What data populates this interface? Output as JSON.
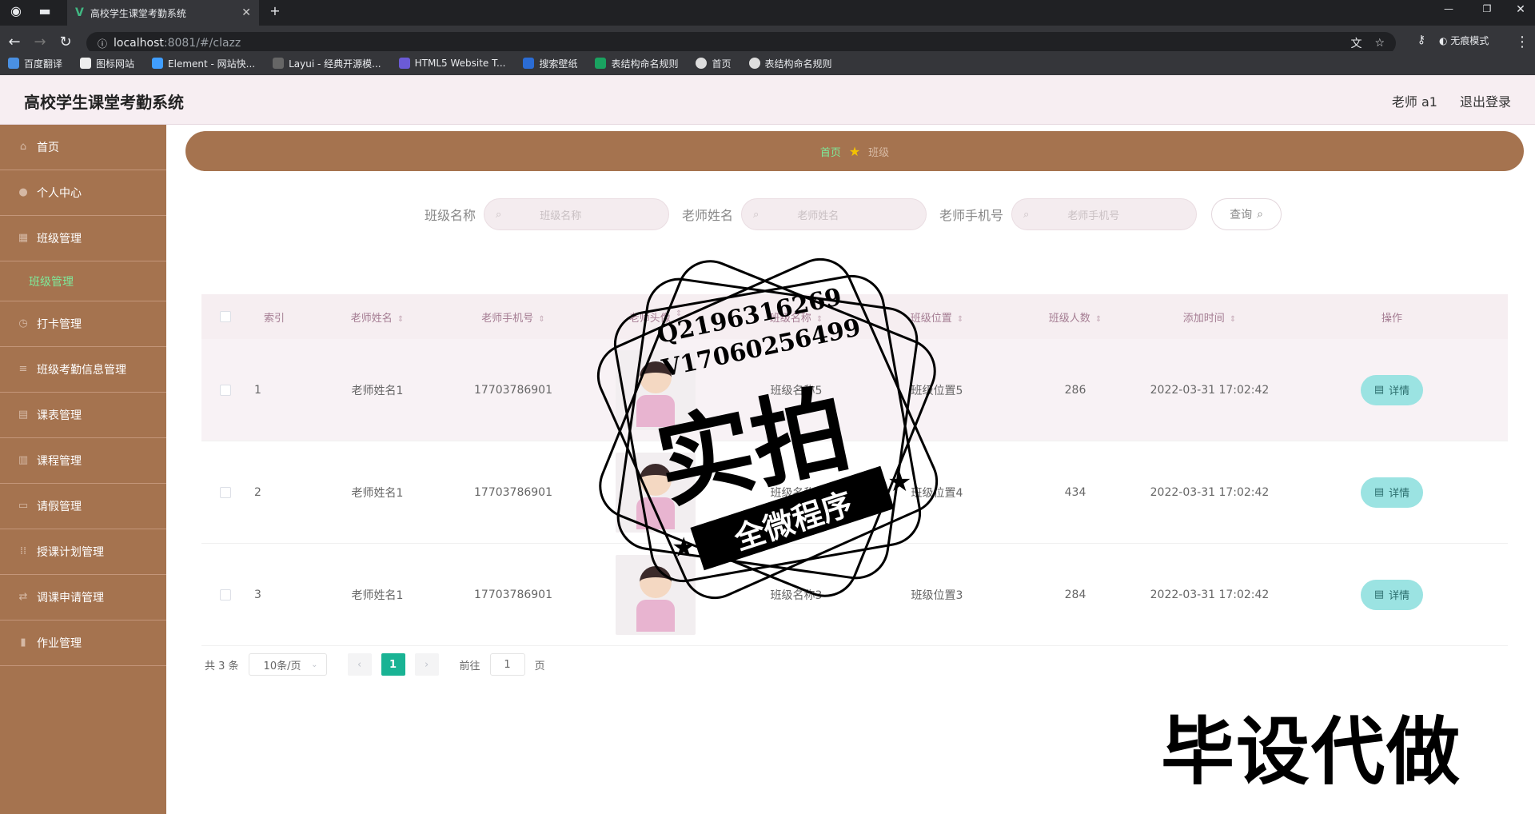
{
  "browser": {
    "tab_title": "高校学生课堂考勤系统",
    "url_host": "localhost",
    "url_rest": ":8081/#/clazz",
    "incognito_label": "无痕模式",
    "bookmarks": [
      "百度翻译",
      "图标网站",
      "Element - 网站快...",
      "Layui - 经典开源模...",
      "HTML5 Website T...",
      "搜索壁纸",
      "表结构命名规则",
      "首页",
      "表结构命名规则"
    ]
  },
  "header": {
    "title": "高校学生课堂考勤系统",
    "user": "老师 a1",
    "logout": "退出登录"
  },
  "sidebar": {
    "items": [
      {
        "label": "首页"
      },
      {
        "label": "个人中心"
      },
      {
        "label": "班级管理"
      },
      {
        "label": "班级管理",
        "sub": true
      },
      {
        "label": "打卡管理"
      },
      {
        "label": "班级考勤信息管理"
      },
      {
        "label": "课表管理"
      },
      {
        "label": "课程管理"
      },
      {
        "label": "请假管理"
      },
      {
        "label": "授课计划管理"
      },
      {
        "label": "调课申请管理"
      },
      {
        "label": "作业管理"
      }
    ]
  },
  "breadcrumb": {
    "home": "首页",
    "current": "班级"
  },
  "search": {
    "f1_label": "班级名称",
    "f1_placeholder": "班级名称",
    "f2_label": "老师姓名",
    "f2_placeholder": "老师姓名",
    "f3_label": "老师手机号",
    "f3_placeholder": "老师手机号",
    "button": "查询"
  },
  "table": {
    "headers": {
      "index": "索引",
      "teacher_name": "老师姓名",
      "teacher_phone": "老师手机号",
      "teacher_avatar": "老师头像",
      "class_name": "班级名称",
      "class_position": "班级位置",
      "class_count": "班级人数",
      "added_time": "添加时间",
      "op": "操作"
    },
    "rows": [
      {
        "index": "1",
        "teacher_name": "老师姓名1",
        "teacher_phone": "17703786901",
        "class_name": "班级名称5",
        "class_position": "班级位置5",
        "class_count": "286",
        "added_time": "2022-03-31 17:02:42"
      },
      {
        "index": "2",
        "teacher_name": "老师姓名1",
        "teacher_phone": "17703786901",
        "class_name": "班级名称4",
        "class_position": "班级位置4",
        "class_count": "434",
        "added_time": "2022-03-31 17:02:42"
      },
      {
        "index": "3",
        "teacher_name": "老师姓名1",
        "teacher_phone": "17703786901",
        "class_name": "班级名称3",
        "class_position": "班级位置3",
        "class_count": "284",
        "added_time": "2022-03-31 17:02:42"
      }
    ],
    "detail_label": "详情"
  },
  "pager": {
    "total": "共 3 条",
    "page_size": "10条/页",
    "current_page": "1",
    "goto_prefix": "前往",
    "goto_value": "1",
    "goto_suffix": "页"
  },
  "watermark": {
    "qq": "Q2196316269",
    "vx": "V17060256499",
    "big": "实拍",
    "ribbon": "全微程序",
    "corner": "毕设代做"
  }
}
